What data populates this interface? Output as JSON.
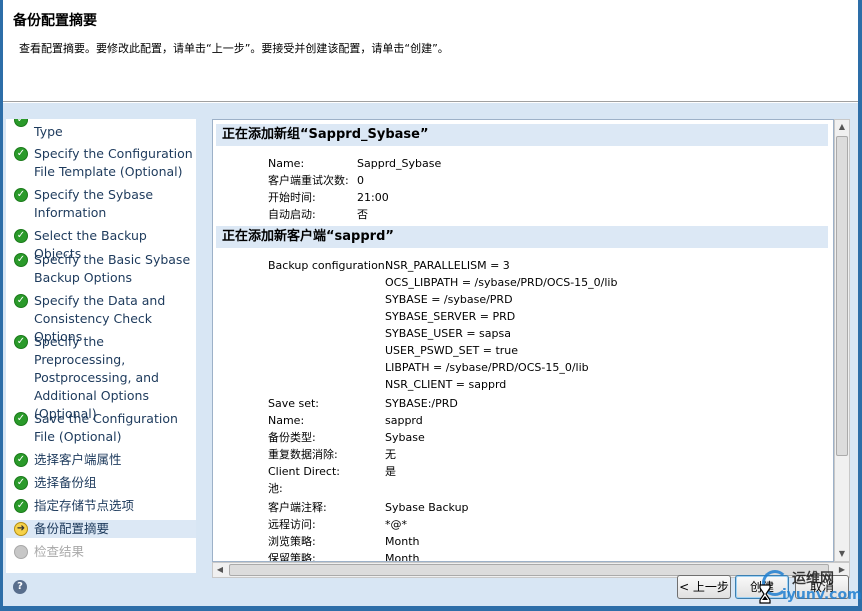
{
  "window": {
    "title": "备份配置摘要",
    "description": "查看配置摘要。要修改此配置，请单击“上一步”。要接受并创建该配置，请单击“创建”。"
  },
  "nav": {
    "items": [
      {
        "label": "Type",
        "state": "done"
      },
      {
        "label": "Specify the Configuration File Template (Optional)",
        "state": "done"
      },
      {
        "label": "Specify the Sybase Information",
        "state": "done"
      },
      {
        "label": "Select the Backup Objects",
        "state": "done"
      },
      {
        "label": "Specify the Basic Sybase Backup Options",
        "state": "done"
      },
      {
        "label": "Specify the Data and Consistency Check Options",
        "state": "done"
      },
      {
        "label": "Specify the Preprocessing, Postprocessing, and Additional Options (Optional)",
        "state": "done"
      },
      {
        "label": "Save the Configuration File (Optional)",
        "state": "done"
      },
      {
        "label": "选择客户端属性",
        "state": "done"
      },
      {
        "label": "选择备份组",
        "state": "done"
      },
      {
        "label": "指定存储节点选项",
        "state": "done"
      },
      {
        "label": "备份配置摘要",
        "state": "current"
      },
      {
        "label": "检查结果",
        "state": "pending"
      }
    ]
  },
  "summary": {
    "group_section": {
      "title": "正在添加新组“Sapprd_Sybase”",
      "rows": [
        {
          "key": "Name:",
          "value": "Sapprd_Sybase"
        },
        {
          "key": "客户端重试次数:",
          "value": "0"
        },
        {
          "key": "开始时间:",
          "value": "21:00"
        },
        {
          "key": "自动启动:",
          "value": "否"
        }
      ]
    },
    "client_section": {
      "title": "正在添加新客户端“sapprd”",
      "backup_config_key": "Backup configuration:",
      "backup_config_values": [
        "NSR_PARALLELISM = 3",
        "OCS_LIBPATH = /sybase/PRD/OCS-15_0/lib",
        "SYBASE = /sybase/PRD",
        "SYBASE_SERVER = PRD",
        "SYBASE_USER = sapsa",
        "USER_PSWD_SET = true",
        "LIBPATH = /sybase/PRD/OCS-15_0/lib",
        "NSR_CLIENT = sapprd"
      ],
      "rows": [
        {
          "key": "Save set:",
          "value": "SYBASE:/PRD"
        },
        {
          "key": "Name:",
          "value": "sapprd"
        },
        {
          "key": "备份类型:",
          "value": "Sybase"
        },
        {
          "key": "重复数据消除:",
          "value": "无"
        },
        {
          "key": "Client Direct:",
          "value": "是"
        },
        {
          "key": "池:",
          "value": ""
        },
        {
          "key": "客户端注释:",
          "value": "Sybase Backup"
        },
        {
          "key": "远程访问:",
          "value": "*@*"
        },
        {
          "key": "浏览策略:",
          "value": "Month"
        },
        {
          "key": "保留策略:",
          "value": "Month"
        }
      ]
    }
  },
  "footer": {
    "help_icon": "?",
    "prev_label": "< 上一步",
    "create_label": "创建",
    "cancel_label": "取消"
  },
  "watermark": {
    "top": "运维网",
    "bottom": "iyunv.com"
  },
  "colors": {
    "accent": "#2d6ea8",
    "done": "#2a9a2a",
    "current": "#f6d24a",
    "pending": "#c7c7c7"
  }
}
